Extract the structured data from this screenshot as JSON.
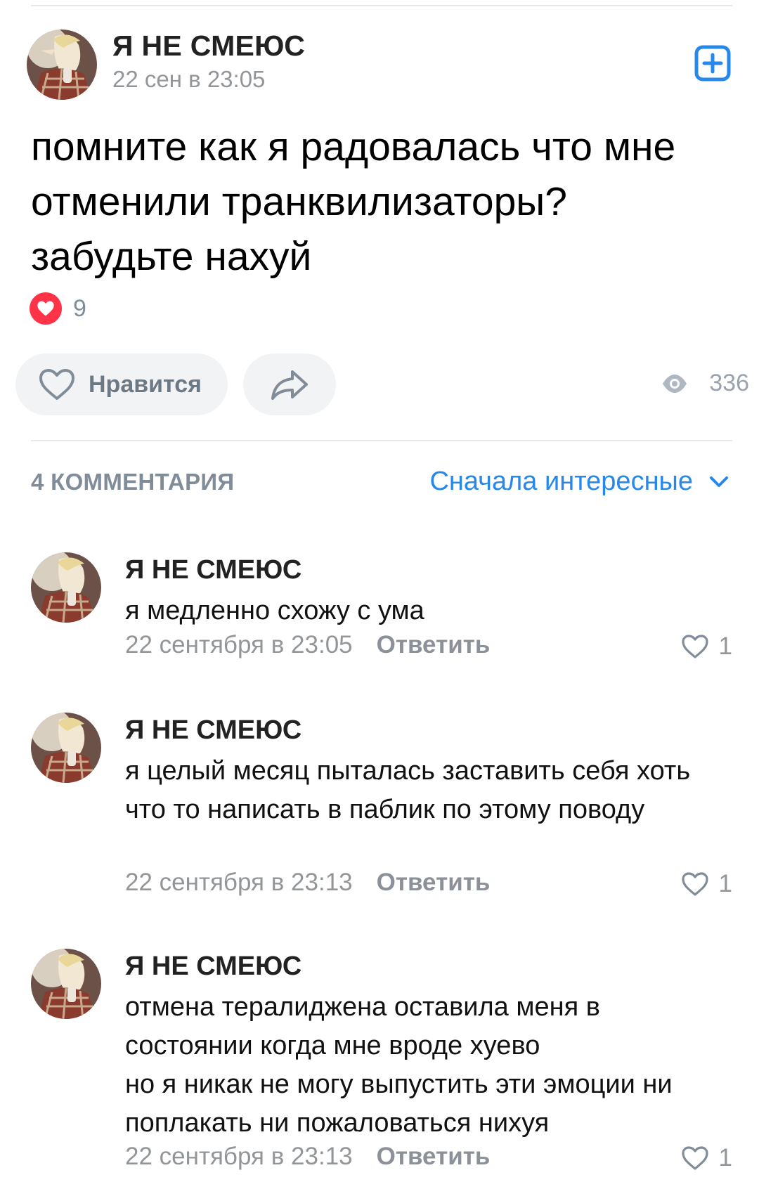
{
  "post": {
    "author": "Я НЕ СМЕЮС",
    "date": "22 сен в 23:05",
    "text": "помните как я радовалась что мне отменили транквилизаторы? забудьте нахуй",
    "reactions_count": "9",
    "like_label": "Нравится",
    "views": "336",
    "add_icon": "plus-square-icon"
  },
  "comments_header": {
    "count_label": "4 КОММЕНТАРИЯ",
    "sort_label": "Сначала интересные"
  },
  "comments": [
    {
      "author": "Я НЕ СМЕЮС",
      "text": "я медленно схожу с ума",
      "date": "22 сентября в 23:05",
      "reply_label": "Ответить",
      "likes": "1"
    },
    {
      "author": "Я НЕ СМЕЮС",
      "text": "я целый месяц пыталась заставить себя хоть что то написать в паблик по этому поводу",
      "date": "22 сентября в 23:13",
      "reply_label": "Ответить",
      "likes": "1"
    },
    {
      "author": "Я НЕ СМЕЮС",
      "text": "отмена тералиджена оставила меня в состоянии когда мне вроде хуево\nно я никак не могу выпустить эти эмоции ни поплакать ни пожаловаться нихуя",
      "date": "22 сентября в 23:13",
      "reply_label": "Ответить",
      "likes": "1"
    }
  ],
  "colors": {
    "accent": "#2688eb",
    "reaction_red": "#ff3347",
    "muted_text": "#939699",
    "button_bg": "#f2f3f5"
  }
}
